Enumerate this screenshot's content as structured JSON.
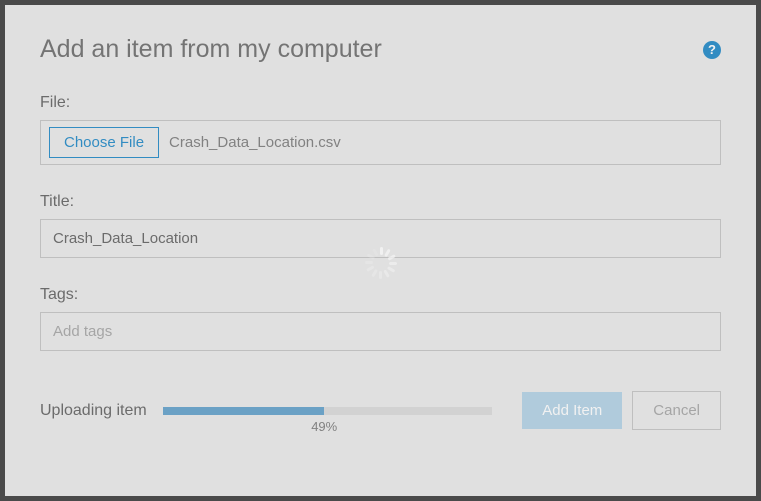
{
  "modal": {
    "title": "Add an item from my computer"
  },
  "file": {
    "label": "File:",
    "choose_label": "Choose File",
    "selected_name": "Crash_Data_Location.csv"
  },
  "title_field": {
    "label": "Title:",
    "value": "Crash_Data_Location"
  },
  "tags_field": {
    "label": "Tags:",
    "placeholder": "Add tags",
    "value": ""
  },
  "upload": {
    "label": "Uploading item",
    "progress_percent": 49,
    "progress_text": "49%"
  },
  "buttons": {
    "add_item": "Add Item",
    "cancel": "Cancel"
  }
}
